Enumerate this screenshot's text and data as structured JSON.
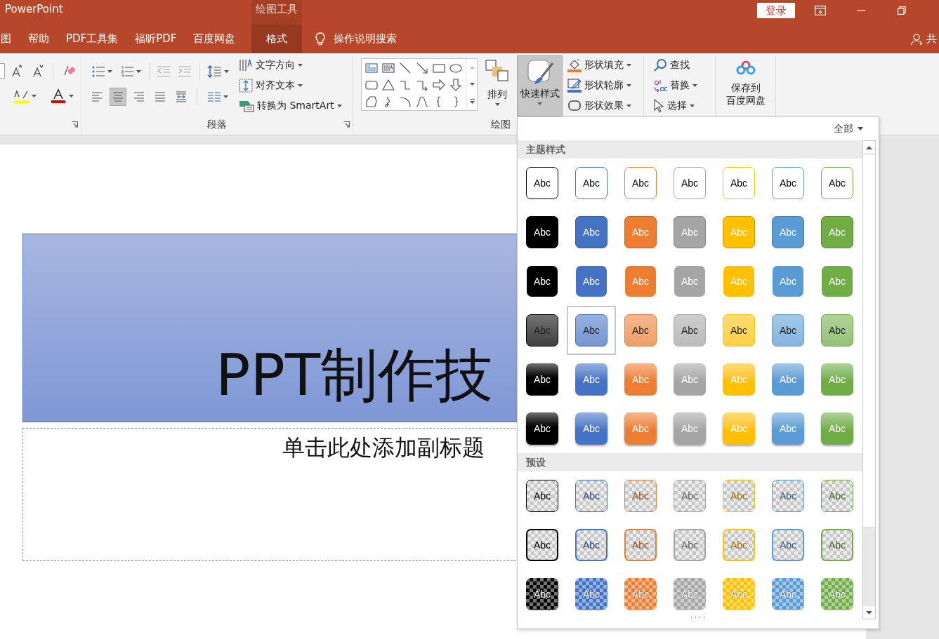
{
  "window": {
    "app_title": "PowerPoint",
    "contextual_group": "绘图工具",
    "sign_in": "登录"
  },
  "tabs": [
    {
      "label": "图",
      "selected": false,
      "kind": "normal"
    },
    {
      "label": "帮助",
      "selected": false,
      "kind": "normal"
    },
    {
      "label": "PDF工具集",
      "selected": false,
      "kind": "normal"
    },
    {
      "label": "福昕PDF",
      "selected": false,
      "kind": "normal"
    },
    {
      "label": "百度网盘",
      "selected": false,
      "kind": "normal"
    },
    {
      "label": "格式",
      "selected": true,
      "kind": "contextual"
    }
  ],
  "tell_me": "操作说明搜索",
  "share": "共",
  "paragraph_group": {
    "label": "段落",
    "alignment": [
      {
        "kind": "left",
        "selected": false
      },
      {
        "kind": "center",
        "selected": true
      },
      {
        "kind": "right",
        "selected": false
      },
      {
        "kind": "justify",
        "selected": false
      },
      {
        "kind": "distributed",
        "selected": false
      }
    ],
    "commands": [
      "文字方向",
      "对齐文本",
      "转换为 SmartArt"
    ]
  },
  "drawing_group": {
    "label": "绘图",
    "arrange": "排列",
    "quick_styles": {
      "label": "快速样式",
      "selected": true
    },
    "shape_commands": [
      "形状填充",
      "形状轮廓",
      "形状效果"
    ]
  },
  "editing": [
    "查找",
    "替换",
    "选择"
  ],
  "baidu_save": [
    "保存到",
    "百度网盘"
  ],
  "slide": {
    "title": "PPT制作技",
    "subtitle_placeholder": "单击此处添加副标题"
  },
  "quick_style_gallery": {
    "filter": "全部",
    "sections": [
      {
        "title": "主题样式",
        "rows": [
          {
            "kind": "outline",
            "items": [
              {
                "label": "Abc",
                "color": "#000000",
                "selected": false
              },
              {
                "label": "Abc",
                "color": "#4472c4",
                "selected": false
              },
              {
                "label": "Abc",
                "color": "#ed7d31",
                "selected": false
              },
              {
                "label": "Abc",
                "color": "#a5a5a5",
                "selected": false
              },
              {
                "label": "Abc",
                "color": "#ffc000",
                "selected": false
              },
              {
                "label": "Abc",
                "color": "#5b9bd5",
                "selected": false
              },
              {
                "label": "Abc",
                "color": "#70ad47",
                "selected": false
              }
            ]
          },
          {
            "kind": "filled-border",
            "items": [
              {
                "label": "Abc",
                "color": "#000000",
                "selected": false
              },
              {
                "label": "Abc",
                "color": "#4472c4",
                "selected": false
              },
              {
                "label": "Abc",
                "color": "#ed7d31",
                "selected": false
              },
              {
                "label": "Abc",
                "color": "#a5a5a5",
                "selected": false
              },
              {
                "label": "Abc",
                "color": "#ffc000",
                "selected": false
              },
              {
                "label": "Abc",
                "color": "#5b9bd5",
                "selected": false
              },
              {
                "label": "Abc",
                "color": "#70ad47",
                "selected": false
              }
            ]
          },
          {
            "kind": "filled",
            "items": [
              {
                "label": "Abc",
                "color": "#000000",
                "selected": false
              },
              {
                "label": "Abc",
                "color": "#4472c4",
                "selected": false
              },
              {
                "label": "Abc",
                "color": "#ed7d31",
                "selected": false
              },
              {
                "label": "Abc",
                "color": "#a5a5a5",
                "selected": false
              },
              {
                "label": "Abc",
                "color": "#ffc000",
                "selected": false
              },
              {
                "label": "Abc",
                "color": "#5b9bd5",
                "selected": false
              },
              {
                "label": "Abc",
                "color": "#70ad47",
                "selected": false
              }
            ]
          },
          {
            "kind": "light",
            "items": [
              {
                "label": "Abc",
                "color": "#000000",
                "selected": false
              },
              {
                "label": "Abc",
                "color": "#4472c4",
                "selected": true
              },
              {
                "label": "Abc",
                "color": "#ed7d31",
                "selected": false
              },
              {
                "label": "Abc",
                "color": "#a5a5a5",
                "selected": false
              },
              {
                "label": "Abc",
                "color": "#ffc000",
                "selected": false
              },
              {
                "label": "Abc",
                "color": "#5b9bd5",
                "selected": false
              },
              {
                "label": "Abc",
                "color": "#70ad47",
                "selected": false
              }
            ]
          },
          {
            "kind": "gradient",
            "items": [
              {
                "label": "Abc",
                "color": "#000000",
                "selected": false
              },
              {
                "label": "Abc",
                "color": "#4472c4",
                "selected": false
              },
              {
                "label": "Abc",
                "color": "#ed7d31",
                "selected": false
              },
              {
                "label": "Abc",
                "color": "#a5a5a5",
                "selected": false
              },
              {
                "label": "Abc",
                "color": "#ffc000",
                "selected": false
              },
              {
                "label": "Abc",
                "color": "#5b9bd5",
                "selected": false
              },
              {
                "label": "Abc",
                "color": "#70ad47",
                "selected": false
              }
            ]
          },
          {
            "kind": "shadow",
            "items": [
              {
                "label": "Abc",
                "color": "#000000",
                "selected": false
              },
              {
                "label": "Abc",
                "color": "#4472c4",
                "selected": false
              },
              {
                "label": "Abc",
                "color": "#ed7d31",
                "selected": false
              },
              {
                "label": "Abc",
                "color": "#a5a5a5",
                "selected": false
              },
              {
                "label": "Abc",
                "color": "#ffc000",
                "selected": false
              },
              {
                "label": "Abc",
                "color": "#5b9bd5",
                "selected": false
              },
              {
                "label": "Abc",
                "color": "#70ad47",
                "selected": false
              }
            ]
          }
        ]
      },
      {
        "title": "预设",
        "rows": [
          {
            "kind": "transparent",
            "items": [
              {
                "label": "Abc",
                "color": "#000000",
                "selected": false
              },
              {
                "label": "Abc",
                "color": "#4472c4",
                "selected": false
              },
              {
                "label": "Abc",
                "color": "#ed7d31",
                "selected": false
              },
              {
                "label": "Abc",
                "color": "#a5a5a5",
                "selected": false
              },
              {
                "label": "Abc",
                "color": "#ffc000",
                "selected": false
              },
              {
                "label": "Abc",
                "color": "#5b9bd5",
                "selected": false
              },
              {
                "label": "Abc",
                "color": "#70ad47",
                "selected": false
              }
            ]
          },
          {
            "kind": "transparent-outline",
            "items": [
              {
                "label": "Abc",
                "color": "#000000",
                "selected": false
              },
              {
                "label": "Abc",
                "color": "#4472c4",
                "selected": false
              },
              {
                "label": "Abc",
                "color": "#ed7d31",
                "selected": false
              },
              {
                "label": "Abc",
                "color": "#a5a5a5",
                "selected": false
              },
              {
                "label": "Abc",
                "color": "#ffc000",
                "selected": false
              },
              {
                "label": "Abc",
                "color": "#5b9bd5",
                "selected": false
              },
              {
                "label": "Abc",
                "color": "#70ad47",
                "selected": false
              }
            ]
          },
          {
            "kind": "semi-filled",
            "items": [
              {
                "label": "Abc",
                "color": "#000000",
                "selected": false
              },
              {
                "label": "Abc",
                "color": "#4472c4",
                "selected": false
              },
              {
                "label": "Abc",
                "color": "#ed7d31",
                "selected": false
              },
              {
                "label": "Abc",
                "color": "#a5a5a5",
                "selected": false
              },
              {
                "label": "Abc",
                "color": "#ffc000",
                "selected": false
              },
              {
                "label": "Abc",
                "color": "#5b9bd5",
                "selected": false
              },
              {
                "label": "Abc",
                "color": "#70ad47",
                "selected": false
              }
            ]
          }
        ]
      }
    ]
  }
}
